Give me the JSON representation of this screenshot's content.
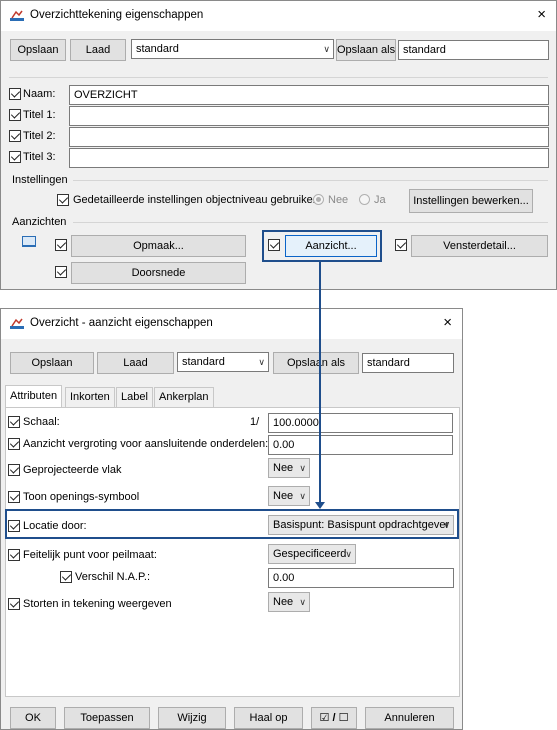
{
  "window1": {
    "title": "Overzichttekening eigenschappen",
    "close": "×",
    "save_label": "Opslaan",
    "load_label": "Laad",
    "preset_value": "standard",
    "save_as_label": "Opslaan als",
    "save_as_value": "standard",
    "naam_label": "Naam:",
    "naam_value": "OVERZICHT",
    "titel1_label": "Titel 1:",
    "titel2_label": "Titel 2:",
    "titel3_label": "Titel 3:",
    "instellingen_group": "Instellingen",
    "detailed_settings_label": "Gedetailleerde instellingen objectniveau gebruiken",
    "radio_nee": "Nee",
    "radio_ja": "Ja",
    "edit_settings_label": "Instellingen bewerken...",
    "aanzichten_group": "Aanzichten",
    "opmaak_label": "Opmaak...",
    "aanzicht_label": "Aanzicht...",
    "vensterdetail_label": "Vensterdetail...",
    "doorsnede_label": "Doorsnede"
  },
  "window2": {
    "title": "Overzicht - aanzicht eigenschappen",
    "close": "×",
    "save_label": "Opslaan",
    "load_label": "Laad",
    "preset_value": "standard",
    "save_as_label": "Opslaan als",
    "save_as_value": "standard",
    "tabs": [
      "Attributen",
      "Inkorten",
      "Label",
      "Ankerplan"
    ],
    "schaal_label": "Schaal:",
    "schaal_prefix": "1/",
    "schaal_value": "100.0000",
    "vergroting_label": "Aanzicht vergroting voor aansluitende onderdelen:",
    "vergroting_value": "0.00",
    "geprojecteerd_label": "Geprojecteerde vlak",
    "geprojecteerd_value": "Nee",
    "openings_label": "Toon openings-symbool",
    "openings_value": "Nee",
    "locatie_label": "Locatie door:",
    "locatie_value": "Basispunt: Basispunt opdrachtgever",
    "feitelijk_label": "Feitelijk punt voor peilmaat:",
    "feitelijk_value": "Gespecificeerd",
    "verschil_label": "Verschil N.A.P.:",
    "verschil_value": "0.00",
    "storten_label": "Storten in tekening weergeven",
    "storten_value": "Nee",
    "ok_label": "OK",
    "apply_label": "Toepassen",
    "modify_label": "Wijzig",
    "get_label": "Haal op",
    "toggle_label": "☑ / ☐",
    "cancel_label": "Annuleren"
  },
  "colors": {
    "highlight": "#1f4e8c",
    "connector": "#1f4e8c"
  }
}
